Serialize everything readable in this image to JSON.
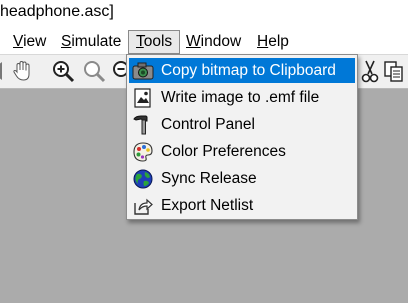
{
  "window": {
    "title": "headphone.asc]"
  },
  "menubar": {
    "items": [
      {
        "label": "View",
        "underline": "V"
      },
      {
        "label": "Simulate",
        "underline": "S"
      },
      {
        "label": "Tools",
        "underline": "T"
      },
      {
        "label": "Window",
        "underline": "W"
      },
      {
        "label": "Help",
        "underline": "H"
      }
    ],
    "open_menu": "Tools"
  },
  "toolbar": {
    "buttons": [
      {
        "name": "pan-hand-icon"
      },
      {
        "name": "zoom-in-icon"
      },
      {
        "name": "zoom-out-icon"
      },
      {
        "name": "zoom-fit-icon"
      },
      {
        "name": "cut-icon"
      },
      {
        "name": "copy-icon"
      }
    ]
  },
  "tools_menu": {
    "items": [
      {
        "label": "Copy bitmap to Clipboard",
        "icon": "camera-icon",
        "highlighted": true
      },
      {
        "label": "Write image to .emf file",
        "icon": "image-file-icon",
        "highlighted": false
      },
      {
        "label": "Control Panel",
        "icon": "hammer-icon",
        "highlighted": false
      },
      {
        "label": "Color Preferences",
        "icon": "palette-icon",
        "highlighted": false
      },
      {
        "label": "Sync Release",
        "icon": "globe-icon",
        "highlighted": false
      },
      {
        "label": "Export Netlist",
        "icon": "export-icon",
        "highlighted": false
      }
    ]
  },
  "colors": {
    "highlight": "#0078d7",
    "menu_background": "#f2f2f2",
    "workspace": "#ababab"
  }
}
